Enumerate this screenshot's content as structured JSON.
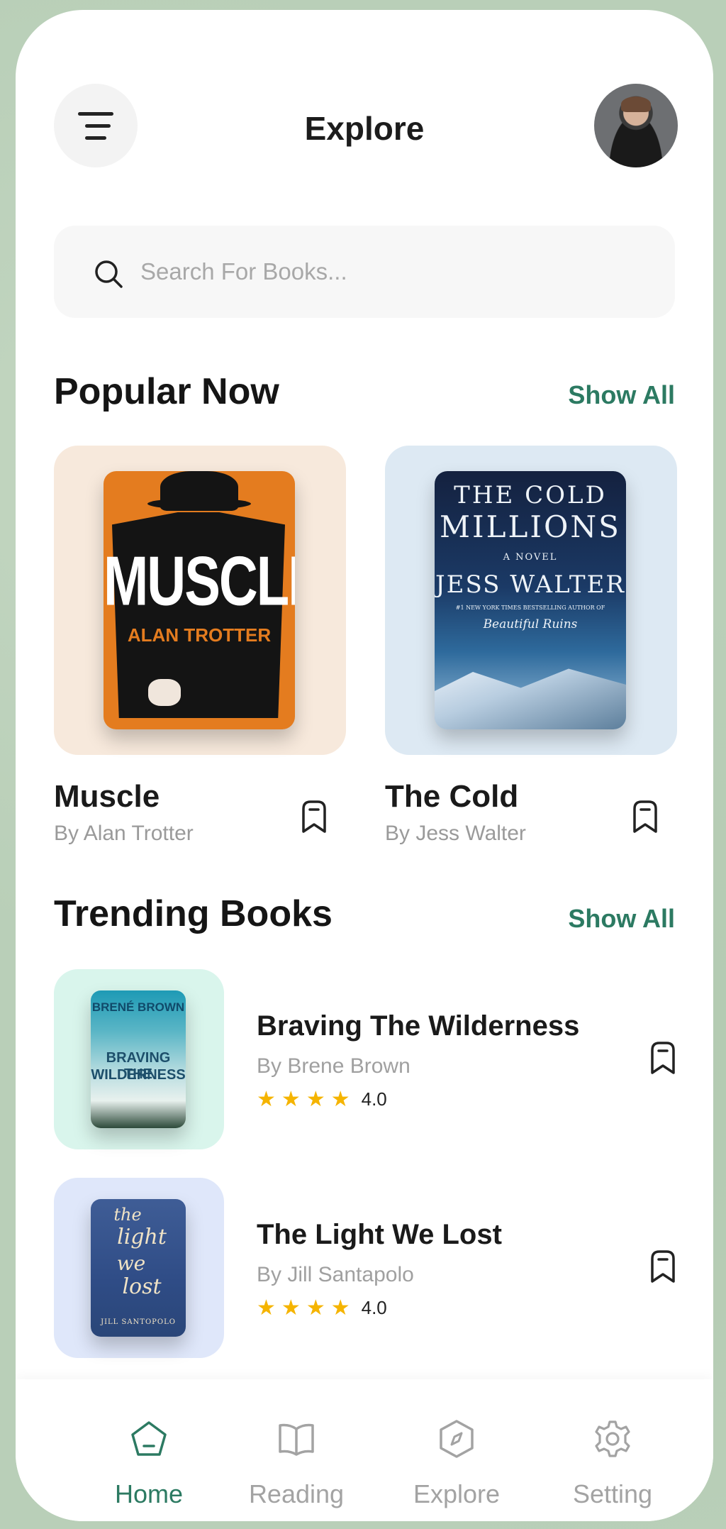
{
  "header": {
    "title": "Explore",
    "menu_icon": "menu-icon",
    "avatar": "user-avatar"
  },
  "search": {
    "placeholder": "Search For Books...",
    "icon": "search-icon"
  },
  "popular": {
    "title": "Popular Now",
    "show_all": "Show All",
    "books": [
      {
        "name": "Muscle",
        "author": "By Alan Trotter",
        "card_color": "#f7e9dc",
        "cover": {
          "title": "MUSCLE",
          "author": "ALAN TROTTER"
        }
      },
      {
        "name": "The Cold",
        "author": "By Jess Walter",
        "card_color": "#dde9f3",
        "cover": {
          "line1": "THE COLD",
          "line2": "MILLIONS",
          "line3": "A NOVEL",
          "line4": "JESS WALTER",
          "line5": "#1 NEW YORK TIMES BESTSELLING AUTHOR OF",
          "line6": "Beautiful Ruins"
        }
      }
    ]
  },
  "trending": {
    "title": "Trending Books",
    "show_all": "Show All",
    "books": [
      {
        "title": "Braving The Wilderness",
        "author": "By Brene Brown",
        "rating": "4.0",
        "stars": 4,
        "card_color": "#d9f5ec",
        "cover": {
          "author": "BRENÉ BROWN",
          "line1": "BRAVING THE",
          "line2": "WILDERNESS"
        }
      },
      {
        "title": "The Light We Lost",
        "author": "By Jill Santapolo",
        "rating": "4.0",
        "stars": 4,
        "card_color": "#dfe7fa",
        "cover": {
          "line1": "the",
          "line2": "light",
          "line3": "we",
          "line4": "lost",
          "author": "JILL SANTOPOLO"
        }
      }
    ]
  },
  "nav": {
    "items": [
      {
        "label": "Home",
        "icon": "home-icon",
        "active": true
      },
      {
        "label": "Reading",
        "icon": "book-icon",
        "active": false
      },
      {
        "label": "Explore",
        "icon": "compass-icon",
        "active": false
      },
      {
        "label": "Setting",
        "icon": "gear-icon",
        "active": false
      }
    ]
  },
  "colors": {
    "accent": "#2c7a62",
    "star": "#f5b400"
  }
}
